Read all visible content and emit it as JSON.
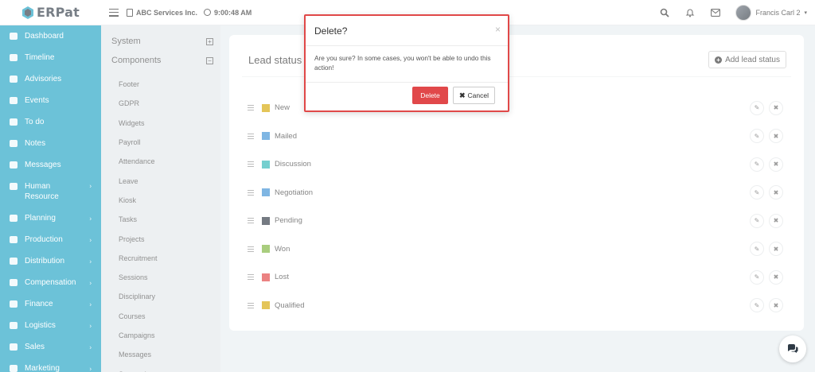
{
  "app": {
    "logo_text": "ERPat"
  },
  "topbar": {
    "company": "ABC Services Inc.",
    "time": "9:00:48 AM",
    "user_name": "Francis Carl 2"
  },
  "sidebar": {
    "items": [
      {
        "label": "Dashboard",
        "icon": "dashboard-icon",
        "has_submenu": false
      },
      {
        "label": "Timeline",
        "icon": "timeline-icon",
        "has_submenu": false
      },
      {
        "label": "Advisories",
        "icon": "bullhorn-icon",
        "has_submenu": false
      },
      {
        "label": "Events",
        "icon": "calendar-icon",
        "has_submenu": false
      },
      {
        "label": "To do",
        "icon": "checkbox-icon",
        "has_submenu": false
      },
      {
        "label": "Notes",
        "icon": "note-icon",
        "has_submenu": false
      },
      {
        "label": "Messages",
        "icon": "envelope-icon",
        "has_submenu": false
      },
      {
        "label": "Human Resource",
        "icon": "users-icon",
        "has_submenu": true
      },
      {
        "label": "Planning",
        "icon": "briefcase-icon",
        "has_submenu": true
      },
      {
        "label": "Production",
        "icon": "flask-icon",
        "has_submenu": true
      },
      {
        "label": "Distribution",
        "icon": "bank-icon",
        "has_submenu": true
      },
      {
        "label": "Compensation",
        "icon": "money-hand-icon",
        "has_submenu": true
      },
      {
        "label": "Finance",
        "icon": "money-icon",
        "has_submenu": true
      },
      {
        "label": "Logistics",
        "icon": "truck-icon",
        "has_submenu": true
      },
      {
        "label": "Sales",
        "icon": "cart-icon",
        "has_submenu": true
      },
      {
        "label": "Marketing",
        "icon": "chart-line-icon",
        "has_submenu": true
      }
    ]
  },
  "subnav": {
    "system_label": "System",
    "components_label": "Components",
    "items": [
      "Footer",
      "GDPR",
      "Widgets",
      "Payroll",
      "Attendance",
      "Leave",
      "Kiosk",
      "Tasks",
      "Projects",
      "Recruitment",
      "Sessions",
      "Disciplinary",
      "Courses",
      "Campaigns",
      "Messages",
      "System Logs"
    ]
  },
  "panel": {
    "title": "Lead status",
    "add_button_label": "Add lead status",
    "statuses": [
      {
        "name": "New",
        "color": "#d6a600"
      },
      {
        "name": "Mailed",
        "color": "#3b8fd4"
      },
      {
        "name": "Discussion",
        "color": "#2cb5b5"
      },
      {
        "name": "Negotiation",
        "color": "#3b8fd4"
      },
      {
        "name": "Pending",
        "color": "#2b3440"
      },
      {
        "name": "Won",
        "color": "#7bb33a"
      },
      {
        "name": "Lost",
        "color": "#e04040"
      },
      {
        "name": "Qualified",
        "color": "#d6a600"
      }
    ]
  },
  "modal": {
    "title": "Delete?",
    "close_symbol": "×",
    "body": "Are you sure? In some cases, you won't be able to undo this action!",
    "delete_label": "Delete",
    "cancel_label": "Cancel"
  },
  "colors": {
    "sidebar_bg": "#1ea2c4",
    "danger": "#e1484a",
    "highlight_border": "#e04848"
  }
}
